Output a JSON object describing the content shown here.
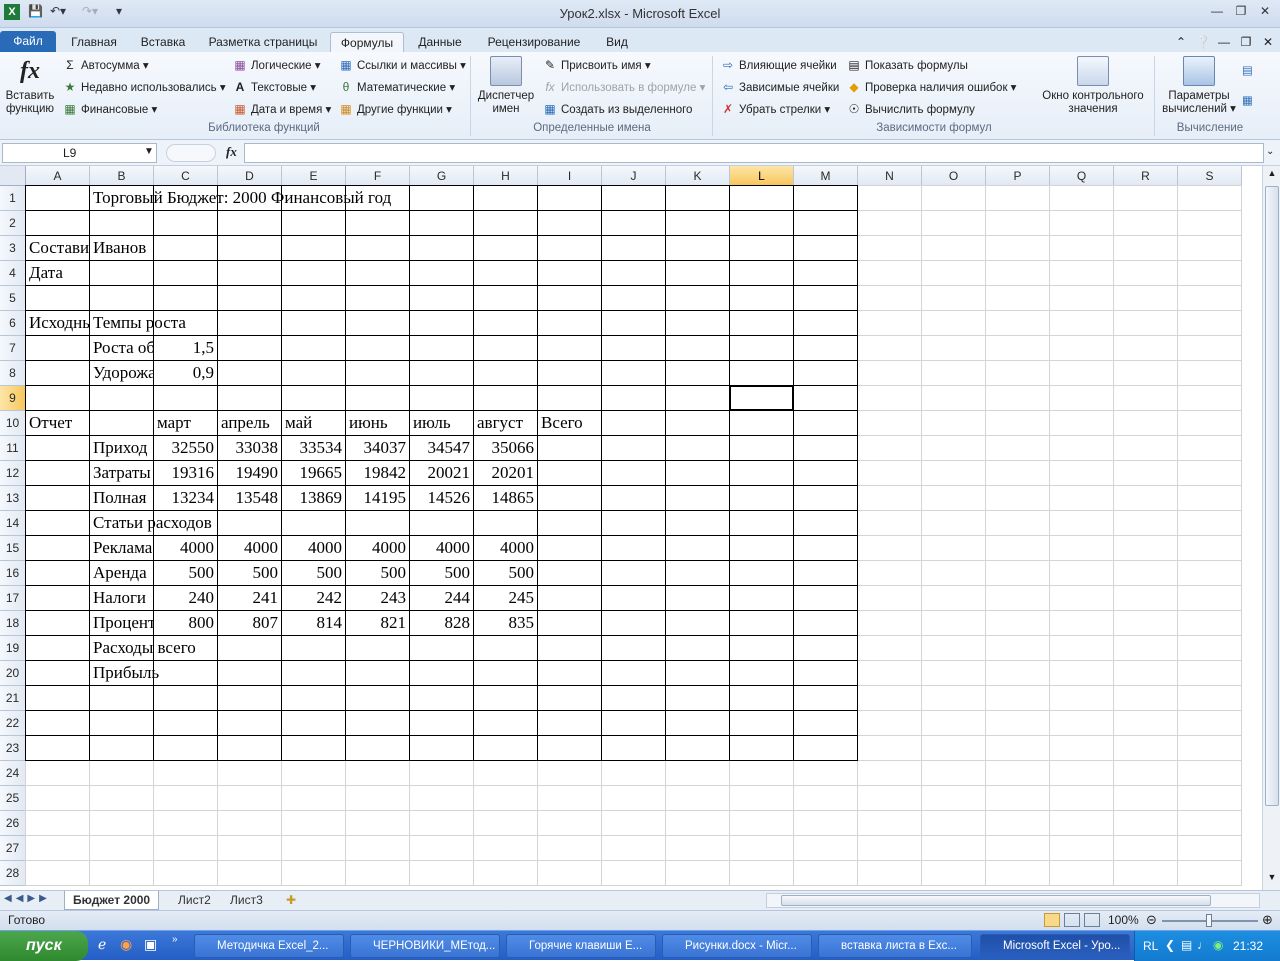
{
  "window": {
    "title": "Урок2.xlsx  -  Microsoft Excel"
  },
  "tabs": [
    "Файл",
    "Главная",
    "Вставка",
    "Разметка страницы",
    "Формулы",
    "Данные",
    "Рецензирование",
    "Вид"
  ],
  "ribbon": {
    "insert_function": "Вставить функцию",
    "lib": {
      "autosum": "Автосумма",
      "recent": "Недавно использовались",
      "financial": "Финансовые",
      "logical": "Логические",
      "text": "Текстовые",
      "datetime": "Дата и время",
      "lookup": "Ссылки и массивы",
      "math": "Математические",
      "other": "Другие функции",
      "group": "Библиотека функций"
    },
    "names": {
      "manager": "Диспетчер имен",
      "define": "Присвоить имя",
      "use": "Использовать в формуле",
      "create": "Создать из выделенного",
      "group": "Определенные имена"
    },
    "audit": {
      "precedents": "Влияющие ячейки",
      "dependents": "Зависимые ячейки",
      "remove": "Убрать стрелки",
      "show": "Показать формулы",
      "errors": "Проверка наличия ошибок",
      "evaluate": "Вычислить формулу",
      "watch": "Окно контрольного значения",
      "group": "Зависимости формул"
    },
    "calc": {
      "options": "Параметры вычислений",
      "group": "Вычисление"
    }
  },
  "formula_bar": {
    "name_box": "L9",
    "fx": "fx",
    "value": ""
  },
  "columns": [
    "A",
    "B",
    "C",
    "D",
    "E",
    "F",
    "G",
    "H",
    "I",
    "J",
    "K",
    "L",
    "M",
    "N",
    "O",
    "P",
    "Q",
    "R",
    "S"
  ],
  "rows": [
    "1",
    "2",
    "3",
    "4",
    "5",
    "6",
    "7",
    "8",
    "9",
    "10",
    "11",
    "12",
    "13",
    "14",
    "15",
    "16",
    "17",
    "18",
    "19",
    "20",
    "21",
    "22",
    "23",
    "24",
    "25",
    "26",
    "27",
    "28"
  ],
  "cells": {
    "B1": "Торговый Бюджет: 2000 Финансовый год",
    "A3": "Составитель",
    "B3": "Иванов",
    "A4": "Дата",
    "A6": "Исходные",
    "B6": "Темпы роста",
    "B7": "Роста объема",
    "C7": "1,5",
    "B8": "Удорожание",
    "C8": "0,9",
    "A10": "Отчет",
    "C10": "март",
    "D10": "апрель",
    "E10": "май",
    "F10": "июнь",
    "G10": "июль",
    "H10": "август",
    "I10": "Всего",
    "B11": "Приход",
    "C11": "32550",
    "D11": "33038",
    "E11": "33534",
    "F11": "34037",
    "G11": "34547",
    "H11": "35066",
    "B12": "Затраты",
    "C12": "19316",
    "D12": "19490",
    "E12": "19665",
    "F12": "19842",
    "G12": "20021",
    "H12": "20201",
    "B13": "Полная",
    "C13": "13234",
    "D13": "13548",
    "E13": "13869",
    "F13": "14195",
    "G13": "14526",
    "H13": "14865",
    "B14": "Статьи расходов",
    "B15": "Реклама",
    "C15": "4000",
    "D15": "4000",
    "E15": "4000",
    "F15": "4000",
    "G15": "4000",
    "H15": "4000",
    "B16": "Аренда",
    "C16": "500",
    "D16": "500",
    "E16": "500",
    "F16": "500",
    "G16": "500",
    "H16": "500",
    "B17": "Налоги",
    "C17": "240",
    "D17": "241",
    "E17": "242",
    "F17": "243",
    "G17": "244",
    "H17": "245",
    "B18": "Проценты",
    "C18": "800",
    "D18": "807",
    "E18": "814",
    "F18": "821",
    "G18": "828",
    "H18": "835",
    "B19": "Расходы всего",
    "B20": "Прибыль"
  },
  "sheets": [
    "Бюджет 2000",
    "Лист2",
    "Лист3"
  ],
  "status": {
    "ready": "Готово",
    "zoom": "100%"
  },
  "taskbar": {
    "start": "пуск",
    "windows": [
      "Методичка Excel_2...",
      "ЧЕРНОВИКИ_МЕтод...",
      "Горячие клавиши E...",
      "Рисунки.docx - Micr...",
      "вставка листа в Exc...",
      "Microsoft Excel - Уро..."
    ],
    "lang": "RL",
    "clock": "21:32"
  }
}
